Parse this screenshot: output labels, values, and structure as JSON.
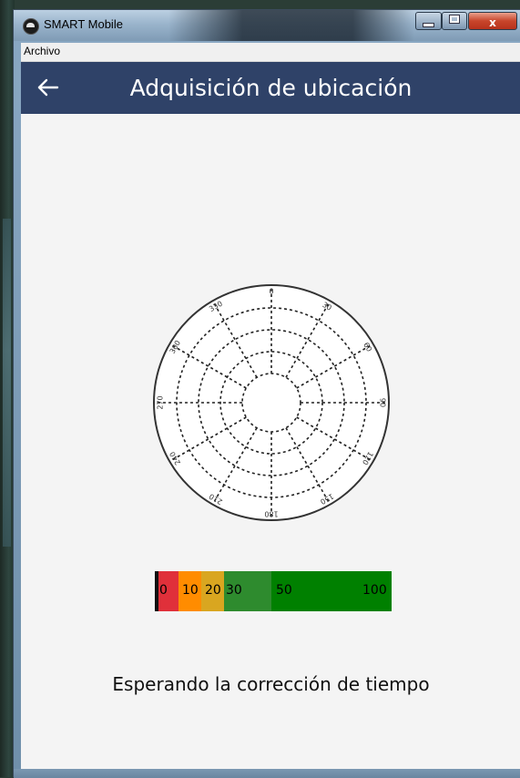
{
  "window": {
    "title": "SMART Mobile"
  },
  "menu": {
    "items": [
      "Archivo"
    ]
  },
  "header": {
    "title": "Adquisición de ubicación"
  },
  "radar": {
    "bearing_labels": [
      "0",
      "30",
      "60",
      "90",
      "120",
      "150",
      "180",
      "210",
      "240",
      "270",
      "300",
      "330"
    ],
    "ring_count": 4
  },
  "signal_bar": {
    "labels": [
      "0",
      "10",
      "20",
      "30",
      "50",
      "100"
    ],
    "colors": [
      "#111111",
      "#e0303a",
      "#ff8c00",
      "#d9a620",
      "#2e8b2e",
      "#008000"
    ]
  },
  "status": {
    "text": "Esperando la corrección de tiempo"
  }
}
